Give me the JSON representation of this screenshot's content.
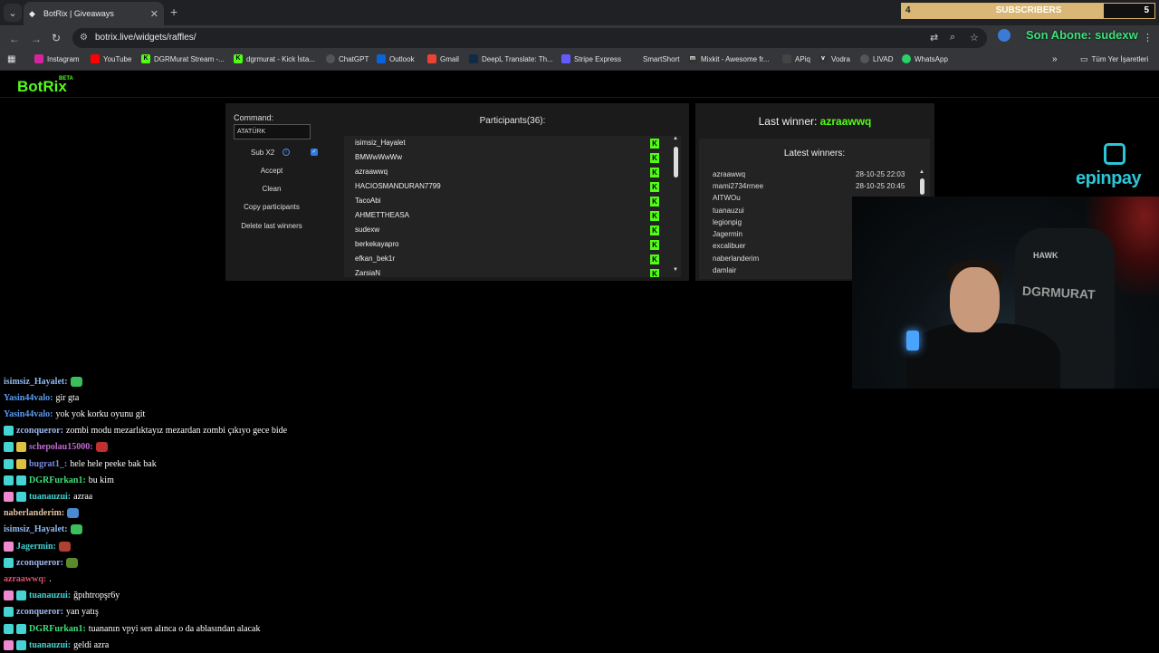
{
  "browser": {
    "tab_title": "BotRix | Giveaways",
    "url": "botrix.live/widgets/raffles/",
    "bookmarks": [
      "Instagram",
      "YouTube",
      "DGRMurat Stream -...",
      "dgrmurat - Kick İsta...",
      "ChatGPT",
      "Outlook",
      "Gmail",
      "DeepL Translate: Th...",
      "Stripe Express",
      "SmartShort",
      "Mixkit - Awesome fr...",
      "APiq",
      "Vodra",
      "LIVAD",
      "WhatsApp"
    ],
    "bookmarks_more": "»",
    "all_bookmarks": "Tüm Yer İşaretleri"
  },
  "overlay": {
    "subs_left": "4",
    "subs_label": "SUBSCRIBERS",
    "subs_right": "5",
    "subs_progress": 0.8,
    "son_abone": "Son Abone: sudexw"
  },
  "botrix": {
    "logo": "BotRix",
    "logo_beta": "BETA",
    "command_label": "Command:",
    "command_value": "ATATÜRK",
    "sub_label": "Sub X2",
    "sub_checked": true,
    "buttons": [
      "Accept",
      "Clean",
      "Copy participants",
      "Delete last winners"
    ],
    "participants_title": "Participants(36):",
    "participants": [
      "isimsiz_Hayalet",
      "BMWwWwWw",
      "azraawwq",
      "HACIOSMANDURAN7799",
      "TacoAbi",
      "AHMETTHEASA",
      "sudexw",
      "berkekayapro",
      "efkan_bek1r",
      "ZarsiaN"
    ],
    "last_winner_label": "Last winner: ",
    "last_winner": "azraawwq",
    "latest_winners_title": "Latest winners:",
    "latest_winners": [
      {
        "name": "azraawwq",
        "date": "28-10-25 22:03"
      },
      {
        "name": "mami2734rrnee",
        "date": "28-10-25 20:45"
      },
      {
        "name": "AITWOu",
        "date": ""
      },
      {
        "name": "tuanauzui",
        "date": ""
      },
      {
        "name": "legionpig",
        "date": ""
      },
      {
        "name": "Jagermin",
        "date": ""
      },
      {
        "name": "excalibuer",
        "date": ""
      },
      {
        "name": "naberlanderim",
        "date": ""
      },
      {
        "name": "damlair",
        "date": ""
      }
    ]
  },
  "sponsor": {
    "name": "epinpay"
  },
  "webcam": {
    "chair_brand": "HAWK",
    "chair_name": "DGRMURAT"
  },
  "chat": [
    {
      "user": "isimsiz_Hayalet:",
      "msg": "",
      "color": "#8fb8f0",
      "badges": [],
      "emote": "#3bbf5a"
    },
    {
      "user": "Yasin44valo:",
      "msg": "gir gta",
      "color": "#5b9bf0",
      "badges": [],
      "emote": ""
    },
    {
      "user": "Yasin44valo:",
      "msg": "yok yok korku oyunu git",
      "color": "#5b9bf0",
      "badges": [],
      "emote": ""
    },
    {
      "user": "zconqueror:",
      "msg": "zombi modu mezarlıktayız mezardan zombi çıkıyo gece bide",
      "color": "#9fb8f0",
      "badges": [
        "#46d3d3"
      ],
      "emote": ""
    },
    {
      "user": "schepolau15000:",
      "msg": "",
      "color": "#c06ad0",
      "badges": [
        "#46d3d3",
        "#e0c040"
      ],
      "emote": "#c03030"
    },
    {
      "user": "bugrat1_:",
      "msg": "hele hele peeke bak bak",
      "color": "#7a8ae0",
      "badges": [
        "#46d3d3",
        "#e0c040"
      ],
      "emote": ""
    },
    {
      "user": "DGRFurkan1:",
      "msg": "bu kim",
      "color": "#3ee07a",
      "badges": [
        "#46d3d3",
        "#46d3d3"
      ],
      "emote": ""
    },
    {
      "user": "tuanauzui:",
      "msg": "azraa",
      "color": "#46d3d3",
      "badges": [
        "#f08ad0",
        "#46d3d3"
      ],
      "emote": ""
    },
    {
      "user": "naberlanderim:",
      "msg": "",
      "color": "#e0c0a0",
      "badges": [],
      "emote": "#4a8ad0"
    },
    {
      "user": "isimsiz_Hayalet:",
      "msg": "",
      "color": "#8fb8f0",
      "badges": [],
      "emote": "#3bbf5a"
    },
    {
      "user": "Jagermin:",
      "msg": "",
      "color": "#46d3d3",
      "badges": [
        "#f08ad0"
      ],
      "emote": "#b04030"
    },
    {
      "user": "zconqueror:",
      "msg": "",
      "color": "#9fb8f0",
      "badges": [
        "#46d3d3"
      ],
      "emote": "#5a8a2a"
    },
    {
      "user": "azraawwq:",
      "msg": ".",
      "color": "#e05070",
      "badges": [],
      "emote": ""
    },
    {
      "user": "tuanauzui:",
      "msg": "ğpıhtropşr6y",
      "color": "#46d3d3",
      "badges": [
        "#f08ad0",
        "#46d3d3"
      ],
      "emote": ""
    },
    {
      "user": "zconqueror:",
      "msg": "yan yatış",
      "color": "#9fb8f0",
      "badges": [
        "#46d3d3"
      ],
      "emote": ""
    },
    {
      "user": "DGRFurkan1:",
      "msg": "tuananın vpyi sen alınca o da ablasından alacak",
      "color": "#3ee07a",
      "badges": [
        "#46d3d3",
        "#46d3d3"
      ],
      "emote": ""
    },
    {
      "user": "tuanauzui:",
      "msg": "geldi azra",
      "color": "#46d3d3",
      "badges": [
        "#f08ad0",
        "#46d3d3"
      ],
      "emote": ""
    }
  ]
}
